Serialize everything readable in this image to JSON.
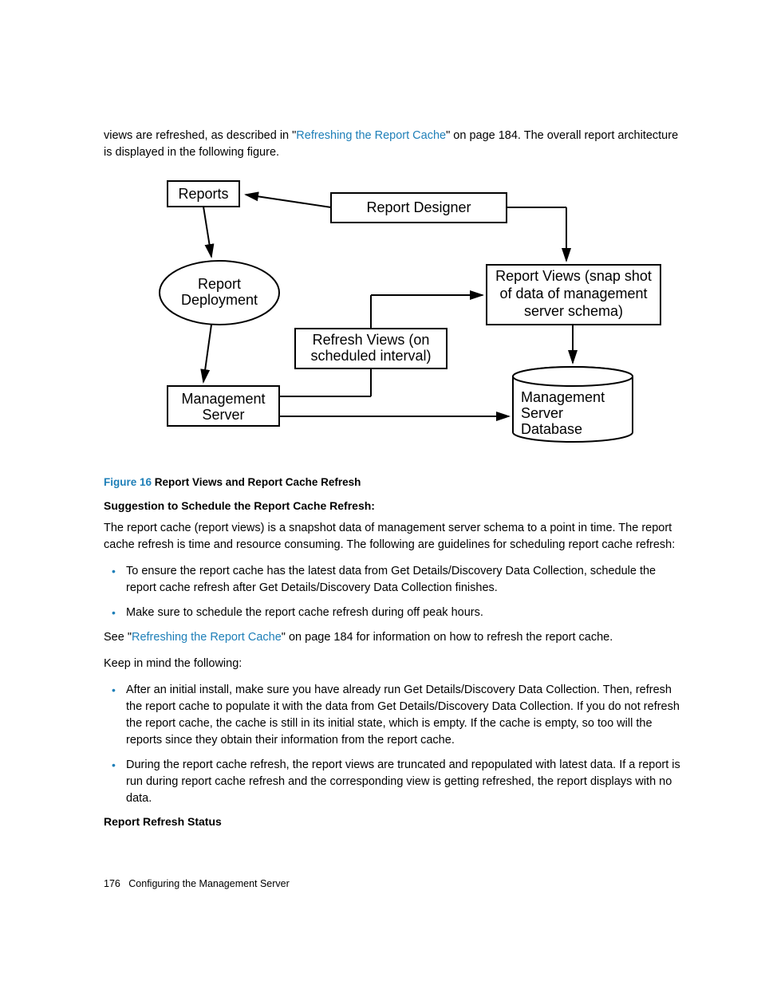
{
  "intro": {
    "pre": "views are refreshed, as described in \"",
    "link": "Refreshing the Report Cache",
    "post": "\" on page 184. The overall report architecture is displayed in the following figure."
  },
  "diagram": {
    "reports": "Reports",
    "report_designer": "Report Designer",
    "report_deployment_l1": "Report",
    "report_deployment_l2": "Deployment",
    "refresh_views_l1": "Refresh Views (on",
    "refresh_views_l2": "scheduled interval)",
    "report_views_l1": "Report Views (snap shot",
    "report_views_l2": "of data of management",
    "report_views_l3": "server schema)",
    "mgmt_server_l1": "Management",
    "mgmt_server_l2": "Server",
    "mgmt_db_l1": "Management",
    "mgmt_db_l2": "Server",
    "mgmt_db_l3": "Database"
  },
  "figure": {
    "num": "Figure 16",
    "title": " Report Views and Report Cache Refresh"
  },
  "suggestion_heading": "Suggestion to Schedule the Report Cache Refresh:",
  "para1": "The report cache (report views) is a snapshot data of management server schema to a point in time. The report cache refresh is time and resource consuming. The following are guidelines for scheduling report cache refresh:",
  "bullets1": [
    "To ensure the report cache has the latest data from Get Details/Discovery Data Collection, schedule the report cache refresh after Get Details/Discovery Data Collection finishes.",
    "Make sure to schedule the report cache refresh during off peak hours."
  ],
  "see": {
    "pre": "See \"",
    "link": "Refreshing the Report Cache",
    "post": "\" on page 184 for information on how to refresh the report cache."
  },
  "para2": "Keep in mind the following:",
  "bullets2": [
    "After an initial install, make sure you have already run Get Details/Discovery Data Collection. Then, refresh the report cache to populate it with the data from Get Details/Discovery Data Collection. If you do not refresh the report cache, the cache is still in its initial state, which is empty. If the cache is empty, so too will the reports since they obtain their information from the report cache.",
    "During the report cache refresh, the report views are truncated and repopulated with latest data. If a report is run during report cache refresh and the corresponding view is getting refreshed, the report displays with no data."
  ],
  "status_heading": "Report Refresh Status",
  "footer": {
    "pagenum": "176",
    "title": "Configuring the Management Server"
  }
}
